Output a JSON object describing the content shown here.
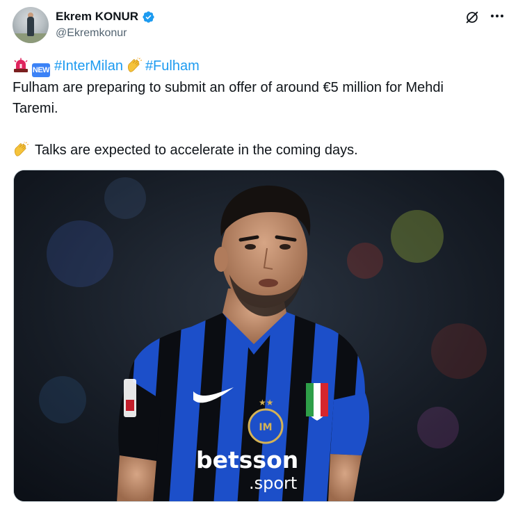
{
  "author": {
    "display_name": "Ekrem KONUR",
    "handle": "@Ekremkonur",
    "verified": true,
    "avatar_icon": "profile-photo"
  },
  "actions": {
    "grok_icon": "grok-icon",
    "more_icon": "more-options-icon"
  },
  "tweet": {
    "emoji_siren": "siren-emoji",
    "emoji_new": "NEW",
    "hashtag_1": "#InterMilan",
    "emoji_hand": "clapping-hand-emoji",
    "hashtag_2": "#Fulham",
    "line_1a": "Fulham are preparing to submit an offer of around €5 million for Mehdi",
    "line_1b": "Taremi.",
    "line_2": "Talks are expected to accelerate in the coming days."
  },
  "media": {
    "description_icon": "player-photo",
    "sponsor_main": "betsson",
    "sponsor_sub": ".sport"
  },
  "colors": {
    "text": "#0f1419",
    "secondary": "#536471",
    "link": "#1d9bf0",
    "verified": "#1d9bf0",
    "inter_blue": "#1a4fc4",
    "inter_black": "#0b0d12"
  }
}
